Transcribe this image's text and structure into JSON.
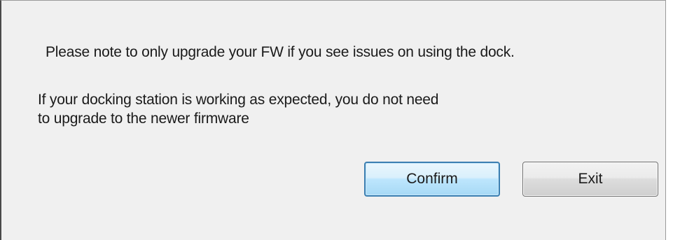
{
  "dialog": {
    "message_primary": "Please note to only upgrade your FW if you see issues on using the dock.",
    "message_secondary_line1": "If your docking station is working as expected, you do not need",
    "message_secondary_line2": "to upgrade to the newer firmware",
    "confirm_label": "Confirm",
    "exit_label": "Exit"
  },
  "colors": {
    "dialog_background": "#f0f0f0",
    "focused_button_border": "#3c7fb1",
    "button_border": "#707070"
  }
}
